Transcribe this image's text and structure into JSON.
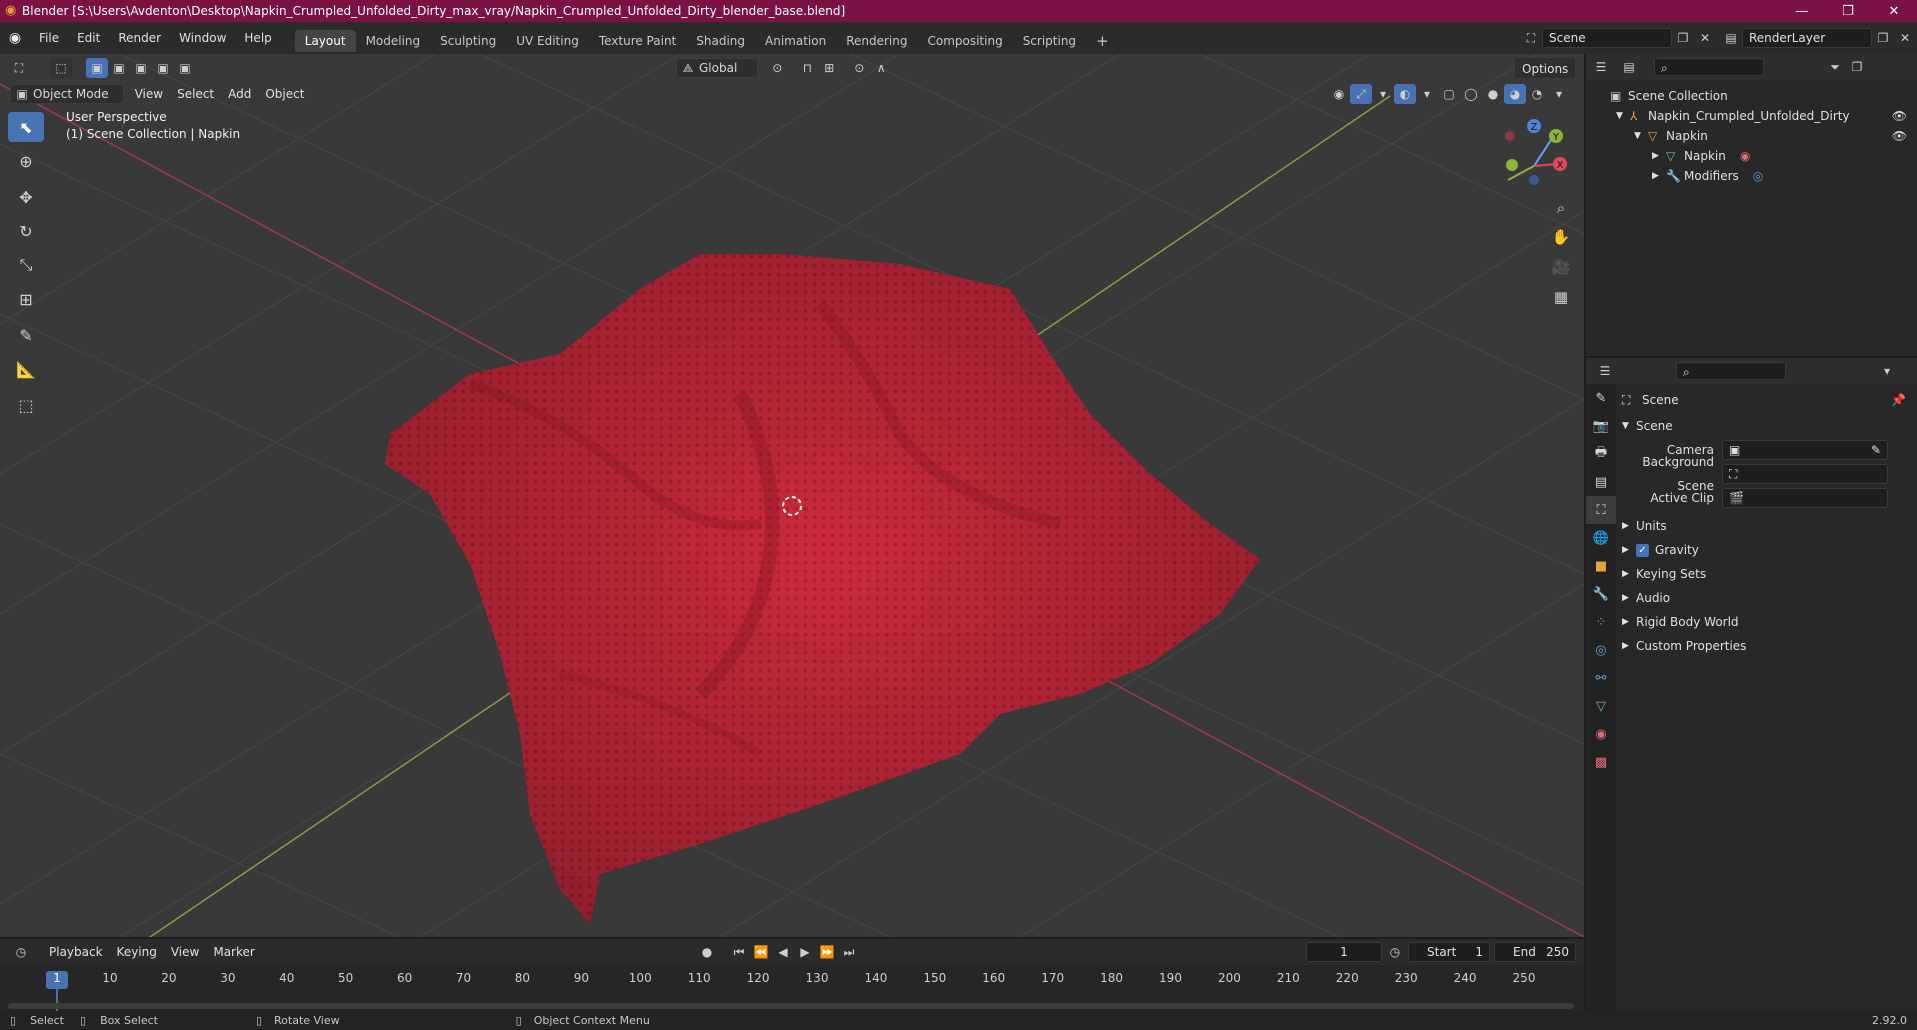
{
  "window": {
    "title": "Blender [S:\\Users\\Avdenton\\Desktop\\Napkin_Crumpled_Unfolded_Dirty_max_vray/Napkin_Crumpled_Unfolded_Dirty_blender_base.blend]"
  },
  "menu": [
    "File",
    "Edit",
    "Render",
    "Window",
    "Help"
  ],
  "workspaces": [
    "Layout",
    "Modeling",
    "Sculpting",
    "UV Editing",
    "Texture Paint",
    "Shading",
    "Animation",
    "Rendering",
    "Compositing",
    "Scripting"
  ],
  "active_workspace": "Layout",
  "scene_field": "Scene",
  "renderlayer_field": "RenderLayer",
  "viewport": {
    "mode": "Object Mode",
    "menus": [
      "View",
      "Select",
      "Add",
      "Object"
    ],
    "transform_orientation": "Global",
    "options_label": "Options",
    "perspective_label": "User Perspective",
    "collection_label": "(1) Scene Collection | Napkin"
  },
  "outliner": {
    "root": "Scene Collection",
    "items": [
      "Napkin_Crumpled_Unfolded_Dirty",
      "Napkin",
      "Napkin",
      "Modifiers"
    ]
  },
  "properties": {
    "header": "Scene",
    "section": "Scene",
    "camera_label": "Camera",
    "background_scene_label": "Background Scene",
    "active_clip_label": "Active Clip",
    "panels": [
      "Units",
      "Gravity",
      "Keying Sets",
      "Audio",
      "Rigid Body World",
      "Custom Properties"
    ],
    "gravity_checked": true
  },
  "timeline": {
    "menus": [
      "Playback",
      "Keying",
      "View",
      "Marker"
    ],
    "current_frame": "1",
    "start_label": "Start",
    "start_value": "1",
    "end_label": "End",
    "end_value": "250",
    "ticks": [
      "1",
      "10",
      "20",
      "30",
      "40",
      "50",
      "60",
      "70",
      "80",
      "90",
      "100",
      "110",
      "120",
      "130",
      "140",
      "150",
      "160",
      "170",
      "180",
      "190",
      "200",
      "210",
      "220",
      "230",
      "240",
      "250"
    ]
  },
  "status": {
    "select": "Select",
    "box_select": "Box Select",
    "rotate_view": "Rotate View",
    "context_menu": "Object Context Menu",
    "version": "2.92.0"
  },
  "colors": {
    "title_bar": "#7a1343",
    "accent": "#4772b3",
    "napkin": "#c8283a"
  }
}
